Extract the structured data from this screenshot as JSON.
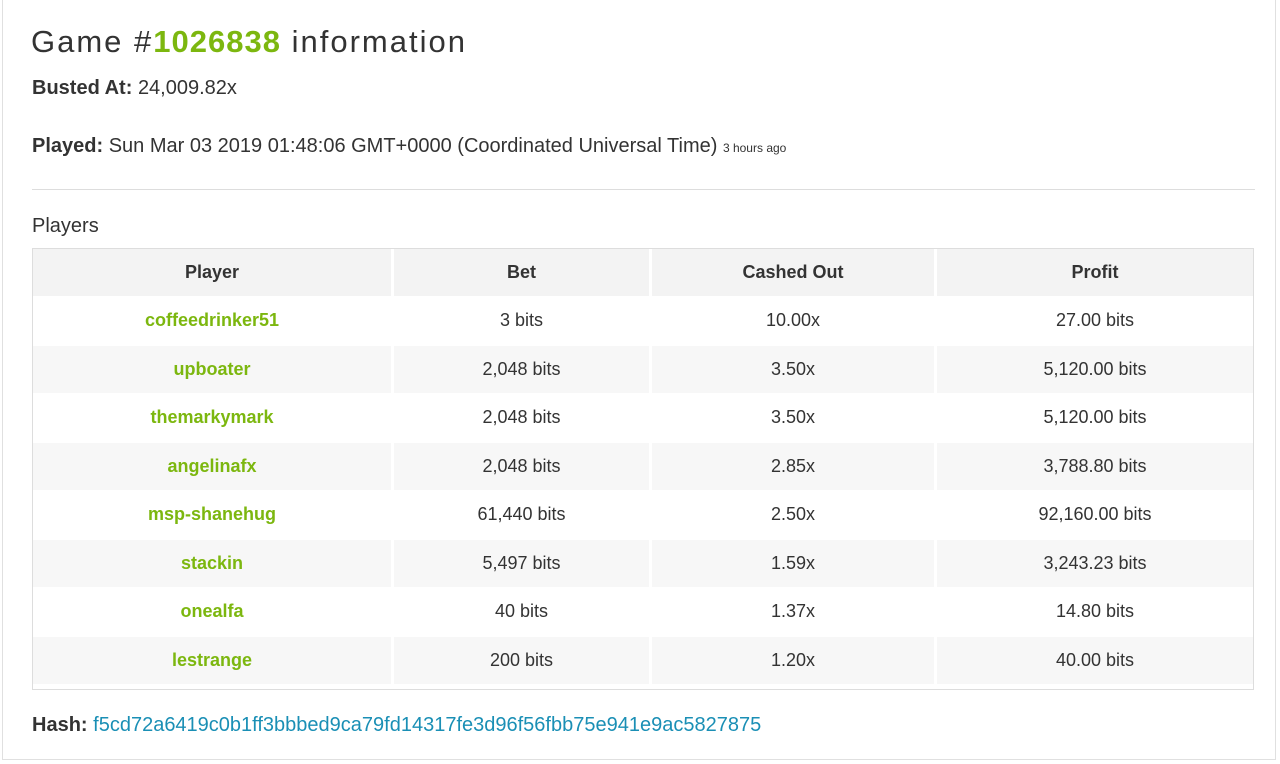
{
  "header": {
    "title_prefix": "Game #",
    "game_id": "1026838",
    "title_suffix": " information"
  },
  "info": {
    "busted_label": "Busted At:",
    "busted_value": "24,009.82x",
    "played_label": "Played:",
    "played_value": "Sun Mar 03 2019 01:48:06 GMT+0000 (Coordinated Universal Time)",
    "played_ago": "3 hours ago"
  },
  "players_section": {
    "heading": "Players",
    "columns": [
      "Player",
      "Bet",
      "Cashed Out",
      "Profit"
    ],
    "rows": [
      {
        "player": "coffeedrinker51",
        "bet": "3 bits",
        "cashed_out": "10.00x",
        "profit": "27.00 bits"
      },
      {
        "player": "upboater",
        "bet": "2,048 bits",
        "cashed_out": "3.50x",
        "profit": "5,120.00 bits"
      },
      {
        "player": "themarkymark",
        "bet": "2,048 bits",
        "cashed_out": "3.50x",
        "profit": "5,120.00 bits"
      },
      {
        "player": "angelinafx",
        "bet": "2,048 bits",
        "cashed_out": "2.85x",
        "profit": "3,788.80 bits"
      },
      {
        "player": "msp-shanehug",
        "bet": "61,440 bits",
        "cashed_out": "2.50x",
        "profit": "92,160.00 bits"
      },
      {
        "player": "stackin",
        "bet": "5,497 bits",
        "cashed_out": "1.59x",
        "profit": "3,243.23 bits"
      },
      {
        "player": "onealfa",
        "bet": "40 bits",
        "cashed_out": "1.37x",
        "profit": "14.80 bits"
      },
      {
        "player": "lestrange",
        "bet": "200 bits",
        "cashed_out": "1.20x",
        "profit": "40.00 bits"
      }
    ]
  },
  "hash": {
    "label": "Hash:",
    "value": "f5cd72a6419c0b1ff3bbbed9ca79fd14317fe3d96f56fbb75e941e9ac5827875"
  },
  "colors": {
    "accent_green": "#7cb70f",
    "link_blue": "#1a8fb5"
  }
}
